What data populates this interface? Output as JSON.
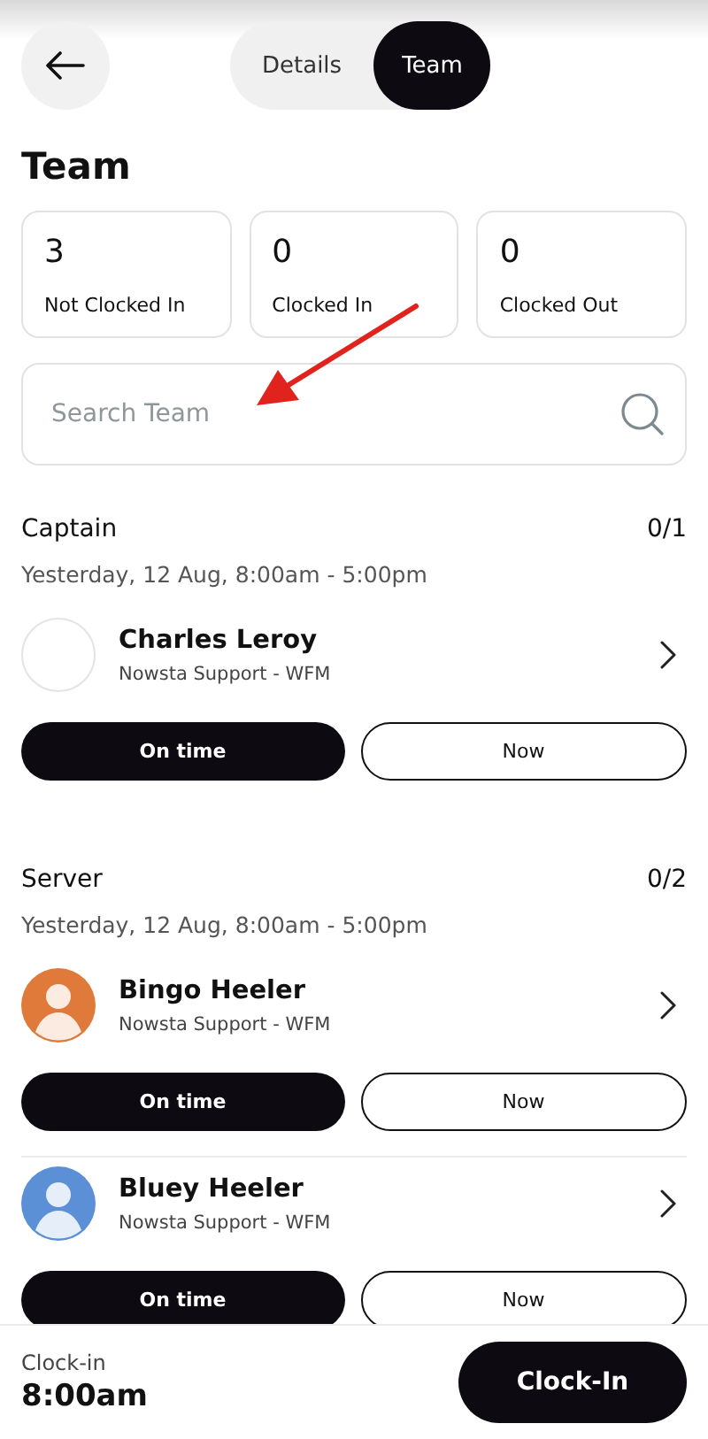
{
  "tabs": [
    {
      "label": "Details",
      "selected": false
    },
    {
      "label": "Team",
      "selected": true
    }
  ],
  "title": "Team",
  "stats": [
    {
      "count": "3",
      "label": "Not Clocked In"
    },
    {
      "count": "0",
      "label": "Clocked In"
    },
    {
      "count": "0",
      "label": "Clocked Out"
    }
  ],
  "search": {
    "placeholder": "Search Team"
  },
  "groups": [
    {
      "role": "Captain",
      "count": "0/1",
      "shift": "Yesterday, 12 Aug, 8:00am - 5:00pm",
      "members": [
        {
          "name": "Charles Leroy",
          "org": "Nowsta Support - WFM",
          "primary": "On time",
          "secondary": "Now"
        }
      ]
    },
    {
      "role": "Server",
      "count": "0/2",
      "shift": "Yesterday, 12 Aug, 8:00am - 5:00pm",
      "members": [
        {
          "name": "Bingo Heeler",
          "org": "Nowsta Support - WFM",
          "color": "#e07a3a",
          "primary": "On time",
          "secondary": "Now"
        },
        {
          "name": "Bluey Heeler",
          "org": "Nowsta Support - WFM",
          "color": "#5b8fd6",
          "primary": "On time",
          "secondary": "Now"
        }
      ]
    }
  ],
  "footer": {
    "label": "Clock-in",
    "time": "8:00am",
    "button": "Clock-In"
  }
}
